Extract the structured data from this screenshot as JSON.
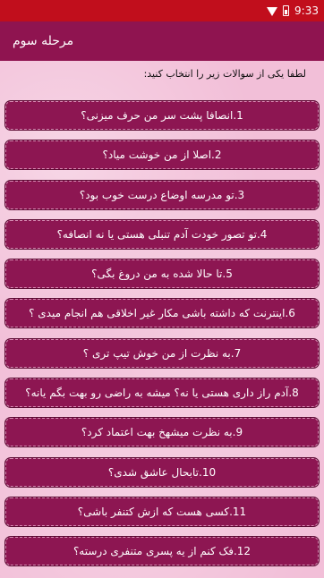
{
  "status_bar": {
    "time": "9:33"
  },
  "app_bar": {
    "title": "مرحله سوم"
  },
  "instruction": "لطفا یکی از سوالات زیر را انتخاب کنید:",
  "questions": [
    "1.انصافا پشت سر من حرف میزنی؟",
    "2.اصلا از من خوشت میاد؟",
    "3.تو مدرسه اوضاع درست خوب بود؟",
    "4.تو تصور خودت آدم تنبلی هستی یا نه انصافه؟",
    "5.تا حالا شده به من دروغ بگی؟",
    "6.اینترنت که داشته باشی مکار غیر اخلاقی هم انجام میدی ؟",
    "7.به نظرت از من خوش تیپ تری ؟",
    "8.آدم راز داری هستی یا نه؟ میشه به راضی رو بهت بگم یانه؟",
    "9.به نظرت میشهخ بهت اعتماد کرد؟",
    "10.تابحال عاشق شدی؟",
    "11.کسی هست که ازش کتنفر باشی؟",
    "12.فک کنم از یه پسری متنفری درسته؟"
  ],
  "colors": {
    "status_bar": "#c10e1c",
    "app_bar": "#8f1450",
    "button": "#8d1652",
    "background": "#f2bfd8"
  }
}
